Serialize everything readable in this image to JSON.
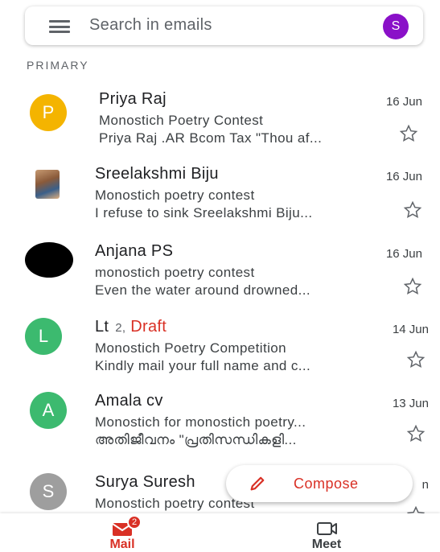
{
  "search": {
    "placeholder": "Search in emails",
    "account_initial": "S"
  },
  "section": {
    "label": "PRIMARY"
  },
  "emails": [
    {
      "sender": "Priya Raj",
      "avatar_letter": "P",
      "avatar_color": "#f4b400",
      "subject": "Monostich Poetry Contest",
      "snippet": "Priya Raj .AR Bcom Tax \"Thou af...",
      "date": "16 Jun",
      "starred": false
    },
    {
      "sender": "Sreelakshmi Biju",
      "avatar_letter": "",
      "avatar_type": "photo",
      "subject": "Monostich poetry contest",
      "snippet": "I refuse to sink Sreelakshmi Biju...",
      "date": "16 Jun",
      "starred": false
    },
    {
      "sender": "Anjana PS",
      "avatar_letter": "",
      "avatar_color": "#000000",
      "subject": "monostich poetry contest",
      "snippet": "Even the water around drowned...",
      "date": "16 Jun",
      "starred": false
    },
    {
      "sender": "Lt",
      "count": "2,",
      "draft_label": "Draft",
      "avatar_letter": "L",
      "avatar_color": "#3cba6f",
      "subject": "Monostich Poetry Competition",
      "snippet": "Kindly mail your full name and c...",
      "date": "14 Jun",
      "starred": false
    },
    {
      "sender": "Amala cv",
      "avatar_letter": "A",
      "avatar_color": "#3cba6f",
      "subject": "Monostich for monostich poetry...",
      "snippet": "അതിജീവനം \"പ്രതിസന്ധികളി...",
      "date": "13 Jun",
      "starred": false
    },
    {
      "sender": "Surya Suresh",
      "avatar_letter": "S",
      "avatar_color": "#9e9e9e",
      "subject": "Monostich poetry contest",
      "date": "n",
      "starred": false
    }
  ],
  "compose": {
    "label": "Compose"
  },
  "bottom_nav": {
    "mail": {
      "label": "Mail",
      "badge": "2"
    },
    "meet": {
      "label": "Meet"
    }
  },
  "colors": {
    "accent_red": "#d93025",
    "account_purple": "#8a10c8"
  }
}
